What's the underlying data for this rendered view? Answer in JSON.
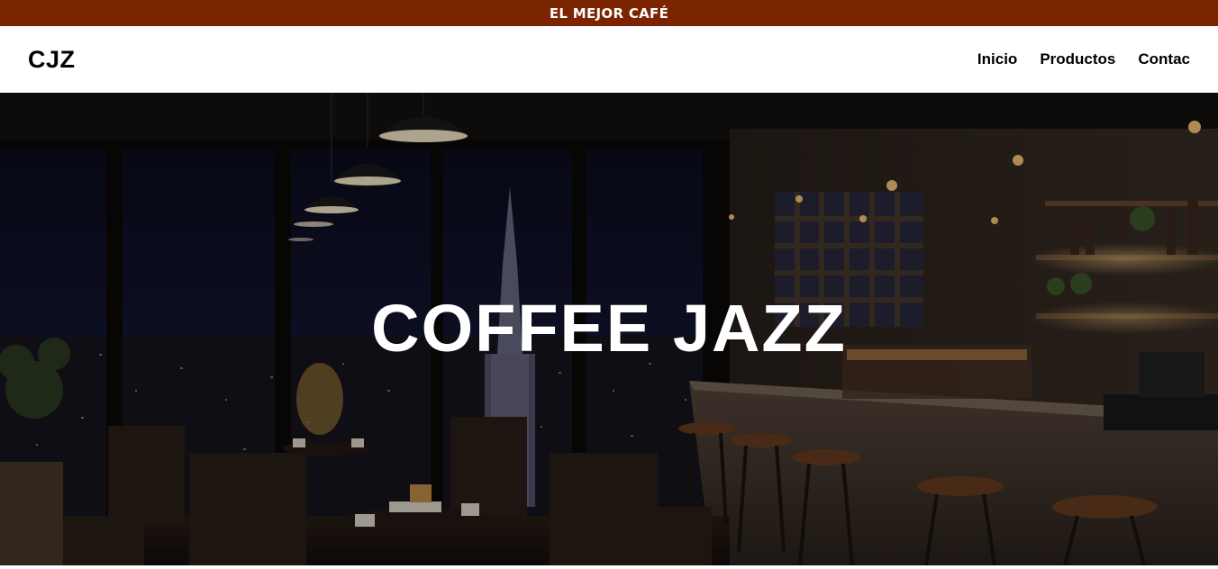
{
  "banner": {
    "text": "EL MEJOR CAFÉ"
  },
  "header": {
    "logo": "CJZ",
    "nav": [
      {
        "label": "Inicio"
      },
      {
        "label": "Productos"
      },
      {
        "label": "Contac"
      }
    ]
  },
  "hero": {
    "title": "COFFEE JAZZ",
    "image": "night-cafe-city-skyline-background"
  },
  "colors": {
    "banner_bg": "#7a2400",
    "text_light": "#ffffff",
    "text_dark": "#000000"
  }
}
